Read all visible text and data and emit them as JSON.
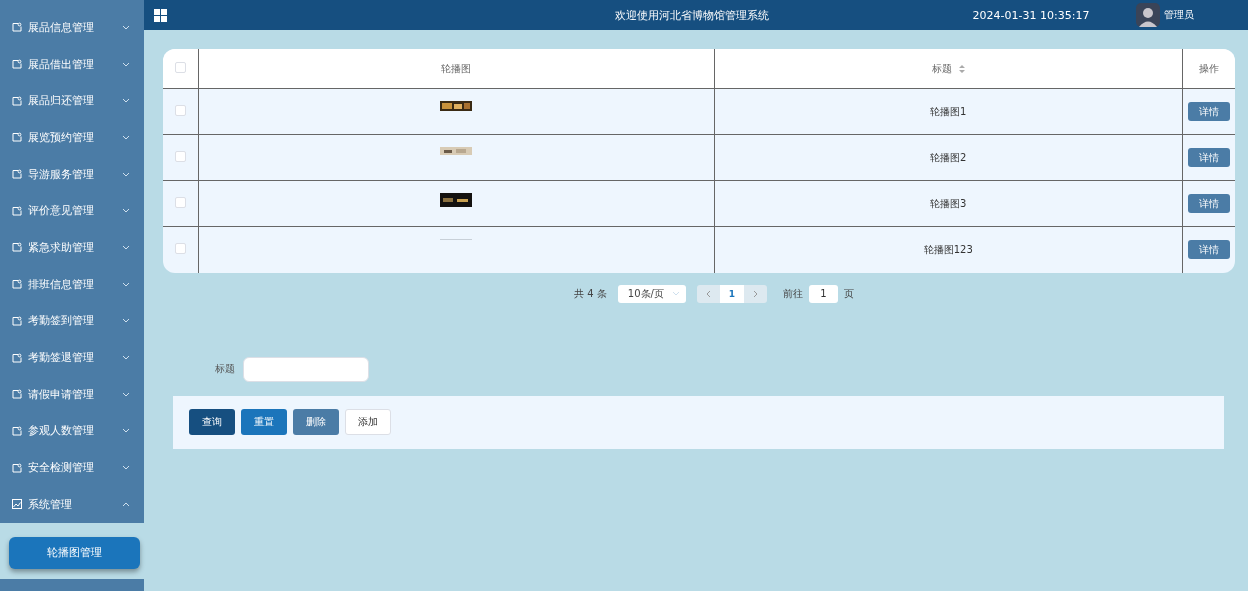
{
  "header": {
    "title": "欢迎使用河北省博物馆管理系统",
    "datetime": "2024-01-31 10:35:17",
    "user": "管理员"
  },
  "sidebar": {
    "items": [
      {
        "label": "展品信息管理",
        "expanded": false
      },
      {
        "label": "展品借出管理",
        "expanded": false
      },
      {
        "label": "展品归还管理",
        "expanded": false
      },
      {
        "label": "展览预约管理",
        "expanded": false
      },
      {
        "label": "导游服务管理",
        "expanded": false
      },
      {
        "label": "评价意见管理",
        "expanded": false
      },
      {
        "label": "紧急求助管理",
        "expanded": false
      },
      {
        "label": "排班信息管理",
        "expanded": false
      },
      {
        "label": "考勤签到管理",
        "expanded": false
      },
      {
        "label": "考勤签退管理",
        "expanded": false
      },
      {
        "label": "请假申请管理",
        "expanded": false
      },
      {
        "label": "参观人数管理",
        "expanded": false
      },
      {
        "label": "安全检测管理",
        "expanded": false
      },
      {
        "label": "系统管理",
        "expanded": true,
        "children": [
          {
            "label": "轮播图管理",
            "selected": true
          }
        ]
      }
    ]
  },
  "table": {
    "all_checked": false,
    "columns": [
      "轮播图",
      "标题",
      "操作"
    ],
    "rows": [
      {
        "title": "轮播图1",
        "checked": false,
        "action": "详情"
      },
      {
        "title": "轮播图2",
        "checked": false,
        "action": "详情"
      },
      {
        "title": "轮播图3",
        "checked": false,
        "action": "详情"
      },
      {
        "title": "轮播图123",
        "checked": false,
        "action": "详情"
      }
    ]
  },
  "pagination": {
    "total": "共 4 条",
    "page_size": "10条/页",
    "pages": [
      {
        "label": "1",
        "selected": true
      }
    ],
    "goto_label": "前往",
    "goto_value": "1",
    "goto_suffix": "页"
  },
  "search": {
    "label": "标题"
  },
  "buttons": [
    {
      "label": "查询",
      "kind": "query"
    },
    {
      "label": "重置",
      "kind": "reset"
    },
    {
      "label": "删除",
      "kind": "delete"
    },
    {
      "label": "添加",
      "kind": "add"
    }
  ]
}
